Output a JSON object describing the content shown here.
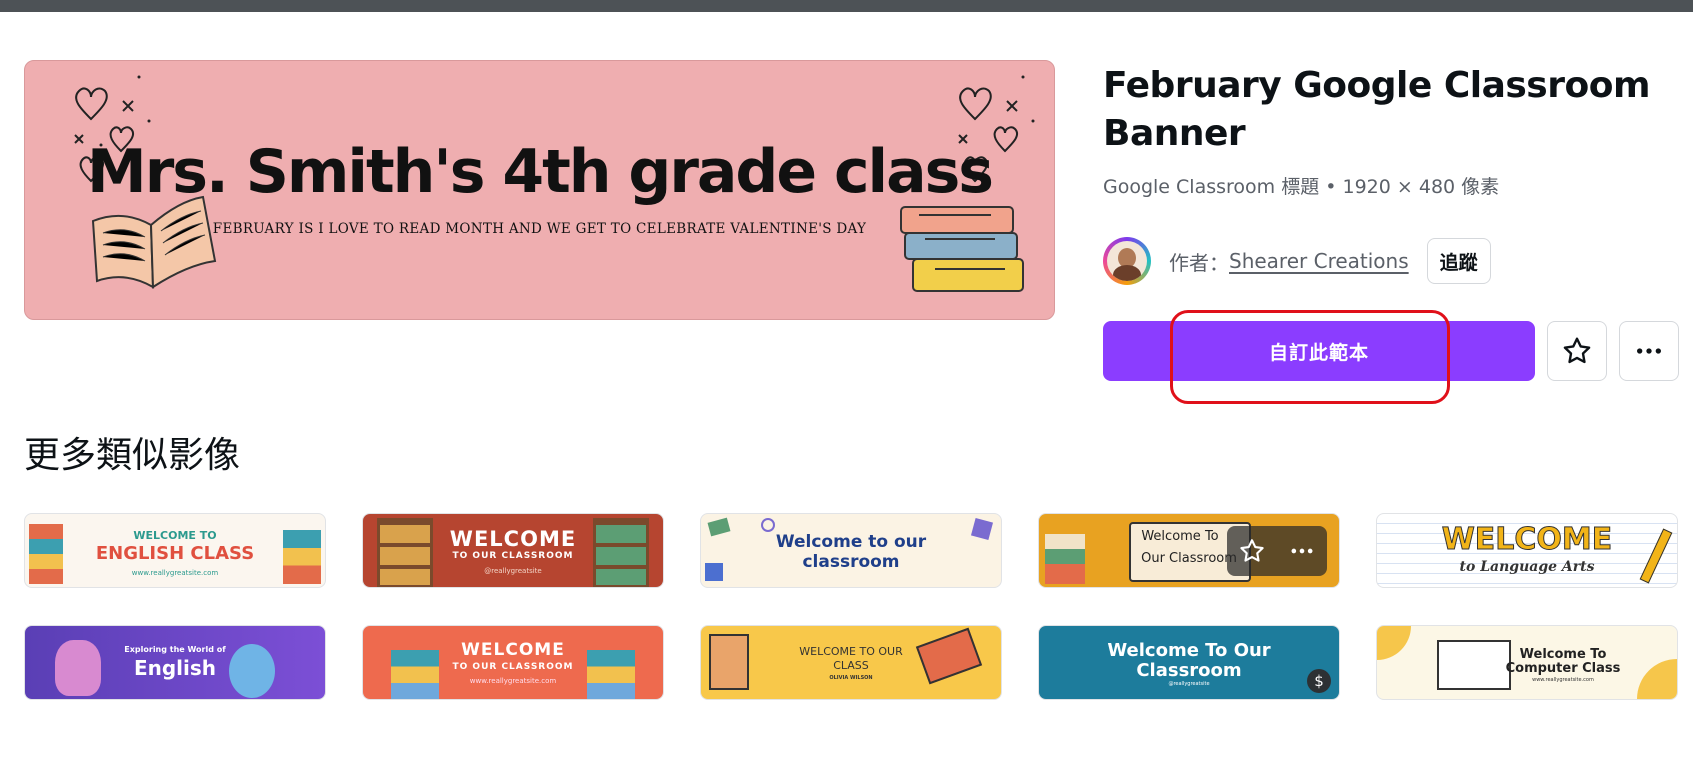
{
  "hero": {
    "title": "Mrs. Smith's 4th grade class",
    "subtitle": "FEBRUARY IS I LOVE TO READ MONTH AND WE GET TO CELEBRATE VALENTINE'S DAY"
  },
  "detail": {
    "title": "February Google Classroom Banner",
    "meta": "Google Classroom 標題 • 1920 × 480 像素",
    "author_label": "作者：",
    "author_name": "Shearer Creations",
    "follow_label": "追蹤",
    "cta_label": "自訂此範本",
    "star_icon": "star-icon",
    "more_icon": "more-horizontal-icon"
  },
  "section": {
    "title": "更多類似影像"
  },
  "colors": {
    "accent": "#8b3dff",
    "highlight": "#e0101a",
    "hero_bg": "#efaeb0"
  },
  "templates": [
    {
      "line1": "WELCOME TO",
      "line2": "ENGLISH CLASS",
      "line3": "www.reallygreatsite.com"
    },
    {
      "line1": "WELCOME",
      "line2": "TO OUR CLASSROOM",
      "line3": "@reallygreatsite"
    },
    {
      "line1": "Welcome to our",
      "line2": "classroom"
    },
    {
      "line1": "Welcome To",
      "line2": "Our Classroom"
    },
    {
      "line1": "WELCOME",
      "line2": "to Language Arts"
    },
    {
      "line1": "Exploring the World of",
      "line2": "English"
    },
    {
      "line1": "WELCOME",
      "line2": "TO OUR CLASSROOM",
      "line3": "www.reallygreatsite.com"
    },
    {
      "line1": "WELCOME TO OUR",
      "line2": "CLASS",
      "line3": "OLIVIA WILSON"
    },
    {
      "line1": "Welcome To Our",
      "line2": "Classroom",
      "line3": "@reallygreatsite"
    },
    {
      "line1": "Welcome To",
      "line2": "Computer Class",
      "line3": "www.reallygreatsite.com"
    }
  ]
}
